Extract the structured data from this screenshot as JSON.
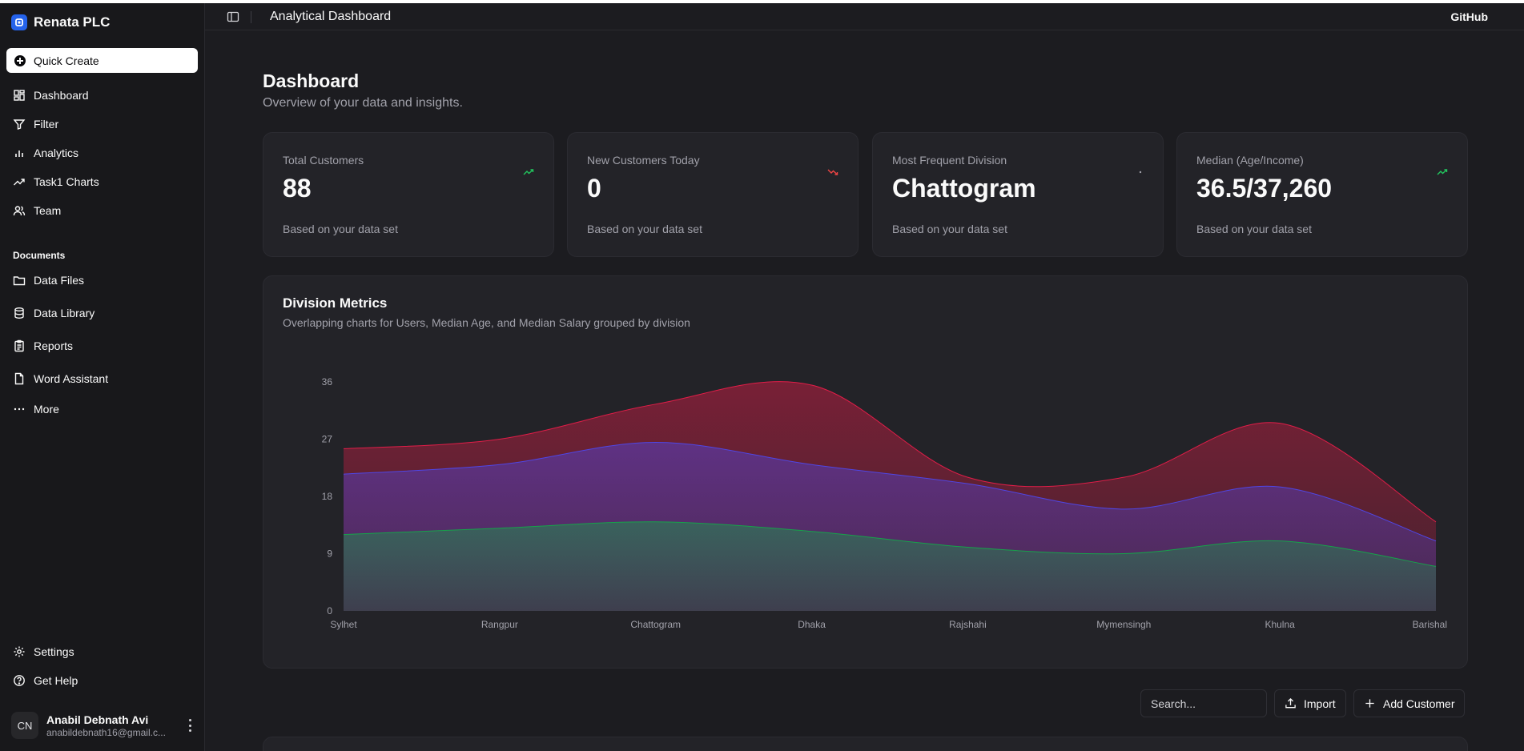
{
  "sidebar": {
    "brand": "Renata PLC",
    "quick_create": "Quick Create",
    "nav": [
      {
        "label": "Dashboard",
        "icon": "dashboard-icon"
      },
      {
        "label": "Filter",
        "icon": "filter-icon"
      },
      {
        "label": "Analytics",
        "icon": "analytics-icon"
      },
      {
        "label": "Task1 Charts",
        "icon": "trending-icon"
      },
      {
        "label": "Team",
        "icon": "team-icon"
      }
    ],
    "documents_label": "Documents",
    "documents": [
      {
        "label": "Data Files",
        "icon": "folder-icon"
      },
      {
        "label": "Data Library",
        "icon": "database-icon"
      },
      {
        "label": "Reports",
        "icon": "clipboard-icon"
      },
      {
        "label": "Word Assistant",
        "icon": "file-icon"
      },
      {
        "label": "More",
        "icon": "more-icon"
      }
    ],
    "footer": [
      {
        "label": "Settings",
        "icon": "gear-icon"
      },
      {
        "label": "Get Help",
        "icon": "help-icon"
      }
    ],
    "user": {
      "initials": "CN",
      "name": "Anabil Debnath Avi",
      "email": "anabildebnath16@gmail.c..."
    }
  },
  "header": {
    "title": "Analytical Dashboard",
    "github": "GitHub"
  },
  "page": {
    "title": "Dashboard",
    "subtitle": "Overview of your data and insights."
  },
  "cards": [
    {
      "title": "Total Customers",
      "value": "88",
      "footer": "Based on your data set",
      "trend": "up",
      "trend_color": "#22c55e"
    },
    {
      "title": "New Customers Today",
      "value": "0",
      "footer": "Based on your data set",
      "trend": "down",
      "trend_color": "#ef4444"
    },
    {
      "title": "Most Frequent Division",
      "value": "Chattogram",
      "footer": "Based on your data set",
      "trend": "neutral",
      "trend_color": "#a1a1aa"
    },
    {
      "title": "Median (Age/Income)",
      "value": "36.5/37,260",
      "footer": "Based on your data set",
      "trend": "up",
      "trend_color": "#22c55e"
    }
  ],
  "chart_panel": {
    "title": "Division Metrics",
    "subtitle": "Overlapping charts for Users, Median Age, and Median Salary grouped by division"
  },
  "chart_data": {
    "type": "area",
    "categories": [
      "Sylhet",
      "Rangpur",
      "Chattogram",
      "Dhaka",
      "Rajshahi",
      "Mymensingh",
      "Khulna",
      "Barishal"
    ],
    "y_ticks": [
      0,
      9,
      18,
      27,
      36
    ],
    "ylim": [
      0,
      36
    ],
    "grid": false,
    "series": [
      {
        "values": [
          25.5,
          27,
          32.5,
          35.5,
          21,
          21,
          29.5,
          14
        ],
        "color": "#e11d48"
      },
      {
        "values": [
          21.5,
          23,
          26.5,
          23,
          20,
          16,
          19.5,
          11
        ],
        "color": "#4f46e5"
      },
      {
        "values": [
          12,
          13,
          14,
          12.5,
          10,
          9,
          11,
          7
        ],
        "color": "#16a34a"
      }
    ]
  },
  "toolbar": {
    "search_placeholder": "Search...",
    "import_label": "Import",
    "add_customer_label": "Add Customer"
  }
}
